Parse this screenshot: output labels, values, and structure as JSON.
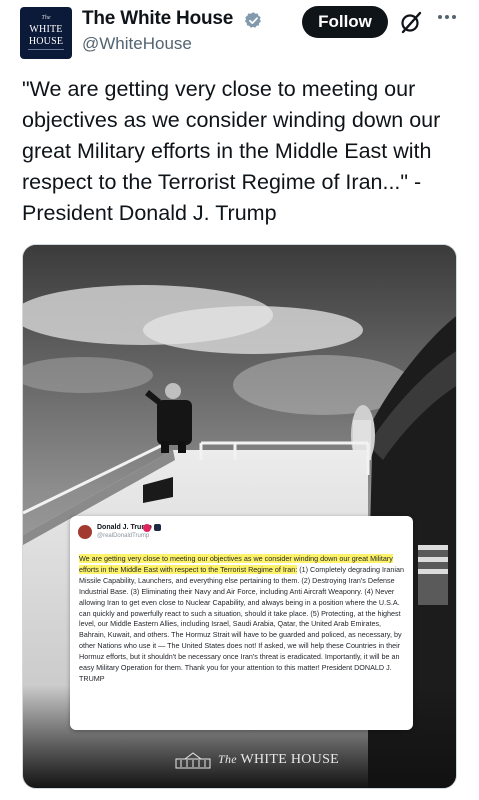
{
  "account": {
    "avatar_lines": [
      "The",
      "WHITE",
      "HOUSE"
    ],
    "name": "The White House",
    "handle": "@WhiteHouse",
    "verified": "gray-verified-badge-icon"
  },
  "actions": {
    "follow_label": "Follow",
    "grok_icon": "grok-icon",
    "more_icon": "more-options-icon"
  },
  "tweet": {
    "text": "\"We are getting very close to meeting our objectives as we consider winding down our great Military efforts in the Middle East with respect to the Terrorist Regime of Iran...\" - President Donald J. Trump"
  },
  "media": {
    "embedded_post": {
      "name": "Donald J. Trump",
      "handle": "@realDonaldTrump",
      "highlighted": "We are getting very close to meeting our objectives as we consider winding down our great Military efforts in the Middle East with respect to the Terrorist Regime of Iran:",
      "rest": " (1) Completely degrading Iranian Missile Capability, Launchers, and everything else pertaining to them. (2) Destroying Iran's Defense Industrial Base. (3) Eliminating their Navy and Air Force, including Anti Aircraft Weaponry. (4) Never allowing Iran to get even close to Nuclear Capability, and always being in a position where the U.S.A. can quickly and powerfully react to such a situation, should it take place. (5) Protecting, at the highest level, our Middle Eastern Allies, including Israel, Saudi Arabia, Qatar, the United Arab Emirates, Bahrain, Kuwait, and others. The Hormuz Strait will have to be guarded and policed, as necessary, by other Nations who use it — The United States does not! If asked, we will help these Countries in their Hormuz efforts, but it shouldn't be necessary once Iran's threat is eradicated. Importantly, it will be an easy Military Operation for them. Thank you for your attention to this matter! President DONALD J. TRUMP"
    },
    "footer": {
      "the": "The",
      "name": "WHITE HOUSE"
    },
    "colors": {
      "highlight": "#fdf26a",
      "footer_bg": "#111111"
    }
  }
}
